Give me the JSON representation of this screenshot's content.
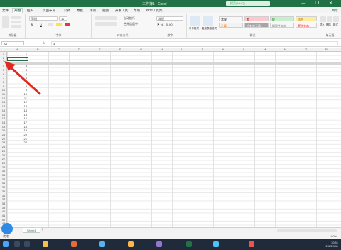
{
  "window": {
    "title": "工作簿1 - Excel",
    "search_placeholder": "搜索(Alt+Q)",
    "window_controls": "— ❐ ✕"
  },
  "menu": {
    "tabs": [
      "文件",
      "开始",
      "插入",
      "页面布局",
      "公式",
      "数据",
      "审阅",
      "视图",
      "开发工具",
      "帮助",
      "PDF工具集"
    ],
    "active_index": 1,
    "share_label": "共享"
  },
  "ribbon": {
    "groups": [
      "剪贴板",
      "字体",
      "对齐方式",
      "数字",
      "样式",
      "单元格"
    ],
    "font_name": "等线",
    "font_size": "11",
    "number_format": "常规",
    "wrap_label": "自动换行",
    "merge_label": "合并后居中",
    "cond_format_label": "条件格式",
    "table_format_label": "套用表格格式",
    "styles": [
      {
        "name": "常规",
        "bg": "#ffffff"
      },
      {
        "name": "差",
        "bg": "#ffc7ce"
      },
      {
        "name": "好",
        "bg": "#c6efce"
      },
      {
        "name": "适中",
        "bg": "#ffeb9c"
      },
      {
        "name": "计算",
        "bg": "#f2f2f2"
      },
      {
        "name": "检查单元格",
        "bg": "#a5a5a5"
      },
      {
        "name": "解释性文本",
        "bg": "#ffffff"
      },
      {
        "name": "警告文本",
        "bg": "#ffffff"
      }
    ],
    "insert_label": "插入",
    "delete_label": "删除",
    "format_label": "格式"
  },
  "formula_bar": {
    "name_box": "A4",
    "fx": "fx",
    "value": "3"
  },
  "grid": {
    "columns": [
      "A",
      "B",
      "C",
      "D",
      "E",
      "F",
      "G",
      "H",
      "I",
      "J",
      "K",
      "L",
      "M",
      "N",
      "O",
      "P"
    ],
    "row_numbers": [
      "1",
      "2",
      "3",
      "4",
      "5",
      "6",
      "7",
      "8",
      "9",
      "10",
      "11",
      "12",
      "13",
      "14",
      "15",
      "16",
      "17",
      "18",
      "19",
      "20",
      "21",
      "22",
      "23",
      "24",
      "25",
      "26",
      "27",
      "28",
      "29",
      "30",
      "31",
      "32",
      "33",
      "34",
      "35",
      "36",
      "37",
      "38",
      "39",
      "40",
      "41",
      "42",
      "43"
    ],
    "values": [
      "1",
      "2",
      "",
      "3",
      "4",
      "5",
      "6",
      "7",
      "8",
      "9",
      "10",
      "11",
      "12",
      "13",
      "14",
      "15",
      "16",
      "17",
      "18",
      "19",
      "20",
      "21",
      "22"
    ],
    "highlighted_row": "4"
  },
  "sheets": {
    "tabs": [
      "Sheet1"
    ],
    "add_symbol": "+"
  },
  "status": {
    "ready": "就绪",
    "zoom": "100%"
  },
  "taskbar": {
    "items": [
      "",
      "",
      "",
      "",
      "",
      "",
      "",
      "",
      ""
    ],
    "clock_time": "10:51",
    "clock_date": "2023/4/11"
  },
  "colors": {
    "accent": "#217346",
    "arrow": "#e0281f",
    "taskbar": "#1f2a3a"
  }
}
